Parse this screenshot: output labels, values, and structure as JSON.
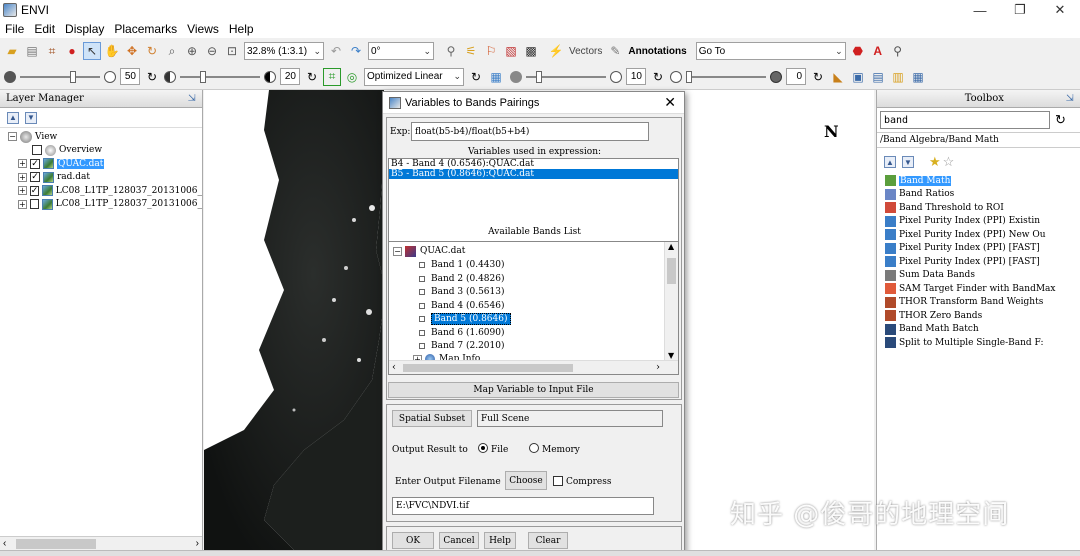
{
  "window": {
    "title": "ENVI",
    "minimize": "—",
    "restore": "❐",
    "close": "✕"
  },
  "menu": [
    "File",
    "Edit",
    "Display",
    "Placemarks",
    "Views",
    "Help"
  ],
  "toolbar1": {
    "zoom": "32.8% (1:3.1)",
    "rotation": "0°",
    "vectors_label": "Vectors",
    "annotations_label": "Annotations",
    "goto": "Go To"
  },
  "toolbar2": {
    "brightness": "50",
    "contrast": "20",
    "stretch": "Optimized Linear",
    "sharpen": "10",
    "transparency": "0"
  },
  "layer_manager": {
    "header": "Layer Manager",
    "root": "View",
    "items": [
      {
        "label": "Overview",
        "checked": false,
        "selected": false
      },
      {
        "label": "QUAC.dat",
        "checked": true,
        "selected": true
      },
      {
        "label": "rad.dat",
        "checked": true,
        "selected": false
      },
      {
        "label": "LC08_L1TP_128037_20131006_",
        "checked": true,
        "selected": false
      },
      {
        "label": "LC08_L1TP_128037_20131006_",
        "checked": false,
        "selected": false
      }
    ]
  },
  "map": {
    "north_label": "N"
  },
  "toolbox": {
    "header": "Toolbox",
    "search_value": "band",
    "path": "/Band Algebra/Band Math",
    "items": [
      {
        "label": "Band Math",
        "icon_color": "#5b9e3c",
        "selected": true
      },
      {
        "label": "Band Ratios",
        "icon_color": "#6a86c6",
        "selected": false
      },
      {
        "label": "Band Threshold to ROI",
        "icon_color": "#d04a3a",
        "selected": false
      },
      {
        "label": "Pixel Purity Index (PPI) Existin",
        "icon_color": "#3a7ec8",
        "selected": false
      },
      {
        "label": "Pixel Purity Index (PPI) New Ou",
        "icon_color": "#3a7ec8",
        "selected": false
      },
      {
        "label": "Pixel Purity Index (PPI) [FAST]",
        "icon_color": "#3a7ec8",
        "selected": false
      },
      {
        "label": "Pixel Purity Index (PPI) [FAST]",
        "icon_color": "#3a7ec8",
        "selected": false
      },
      {
        "label": "Sum Data Bands",
        "icon_color": "#7a7a7a",
        "selected": false
      },
      {
        "label": "SAM Target Finder with BandMax",
        "icon_color": "#e05a3a",
        "selected": false
      },
      {
        "label": "THOR Transform Band Weights",
        "icon_color": "#b04a2a",
        "selected": false
      },
      {
        "label": "THOR Zero Bands",
        "icon_color": "#b04a2a",
        "selected": false
      },
      {
        "label": "Band Math Batch",
        "icon_color": "#2a4a7a",
        "selected": false
      },
      {
        "label": "Split to Multiple Single-Band F:",
        "icon_color": "#2a4a7a",
        "selected": false
      }
    ]
  },
  "dialog": {
    "title": "Variables to Bands Pairings",
    "exp_label": "Exp:",
    "expression": "float(b5-b4)/float(b5+b4)",
    "vars_label": "Variables used in expression:",
    "variables": [
      {
        "text": "B4 - Band 4 (0.6546):QUAC.dat",
        "selected": false
      },
      {
        "text": "B5 - Band 5 (0.8646):QUAC.dat",
        "selected": true
      }
    ],
    "bands_label": "Available Bands List",
    "file": "QUAC.dat",
    "bands": [
      {
        "text": "Band 1 (0.4430)",
        "selected": false
      },
      {
        "text": "Band 2 (0.4826)",
        "selected": false
      },
      {
        "text": "Band 3 (0.5613)",
        "selected": false
      },
      {
        "text": "Band 4 (0.6546)",
        "selected": false
      },
      {
        "text": "Band 5 (0.8646)",
        "selected": true
      },
      {
        "text": "Band 6 (1.6090)",
        "selected": false
      },
      {
        "text": "Band 7 (2.2010)",
        "selected": false
      }
    ],
    "map_info": "Map Info",
    "map_variable_button": "Map Variable to Input File",
    "spatial_subset_button": "Spatial Subset",
    "spatial_subset_value": "Full Scene",
    "output_result_label": "Output Result to",
    "file_option": "File",
    "memory_option": "Memory",
    "output_to": "File",
    "output_filename_label": "Enter Output Filename",
    "choose_button": "Choose",
    "compress_label": "Compress",
    "output_filename": "E:\\FVC\\NDVI.tif",
    "ok": "OK",
    "cancel": "Cancel",
    "help": "Help",
    "clear": "Clear"
  },
  "watermark": "知乎 @俊哥的地理空间"
}
